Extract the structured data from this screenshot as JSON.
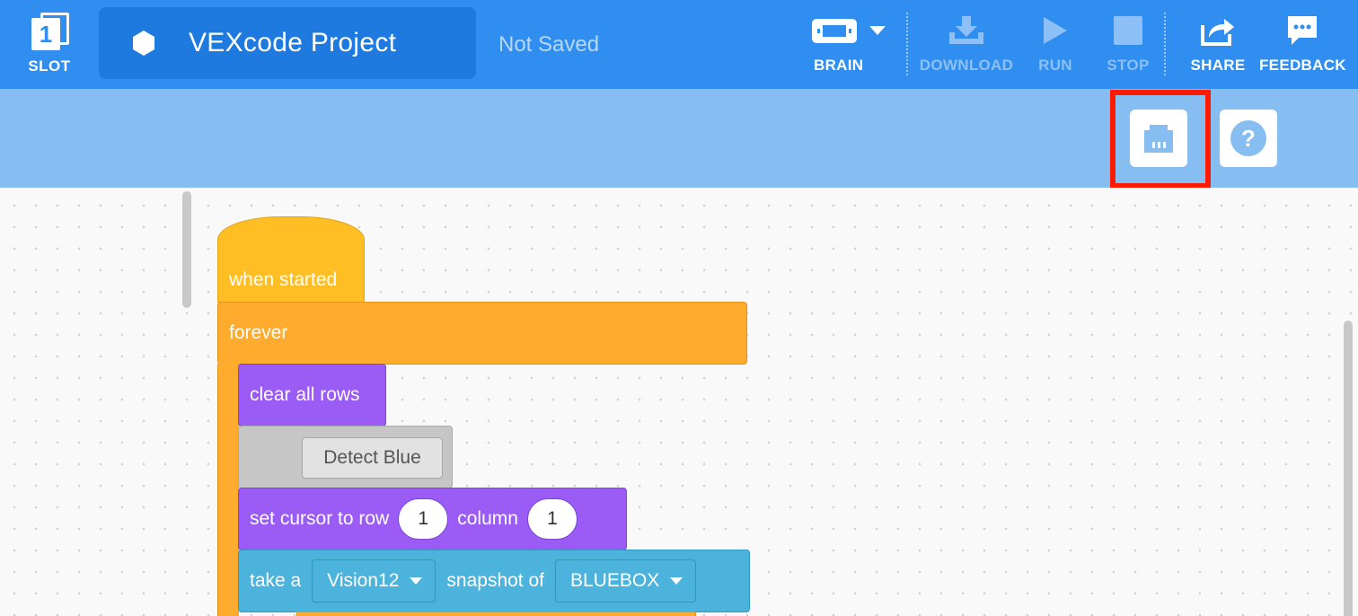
{
  "header": {
    "slot": {
      "number": "1",
      "label": "SLOT"
    },
    "project_name": "VEXcode Project",
    "save_status": "Not Saved",
    "brain_label": "BRAIN",
    "download_label": "DOWNLOAD",
    "run_label": "RUN",
    "stop_label": "STOP",
    "share_label": "SHARE",
    "feedback_label": "FEEDBACK"
  },
  "subtoolbar": {
    "buttons": [
      {
        "icon": "devices-icon",
        "highlighted": true
      },
      {
        "icon": "help-icon",
        "glyph": "?",
        "highlighted": false
      }
    ]
  },
  "blocks": {
    "hat": "when started",
    "forever": "forever",
    "clear_rows": "clear all rows",
    "comment": "Detect Blue",
    "set_cursor": {
      "prefix": "set cursor to row",
      "row": "1",
      "middle": "column",
      "column": "1"
    },
    "snapshot": {
      "prefix": "take a",
      "sensor": "Vision12",
      "middle": "snapshot of",
      "signature": "BLUEBOX"
    }
  },
  "colors": {
    "toolbar": "#2f8ef0",
    "subtoolbar": "#86bef2",
    "event_block": "#ffbf24",
    "control_block": "#ffab2e",
    "looks_block": "#9a5cf5",
    "sensing_block": "#4cb3dc",
    "highlight": "#ff1a00"
  }
}
